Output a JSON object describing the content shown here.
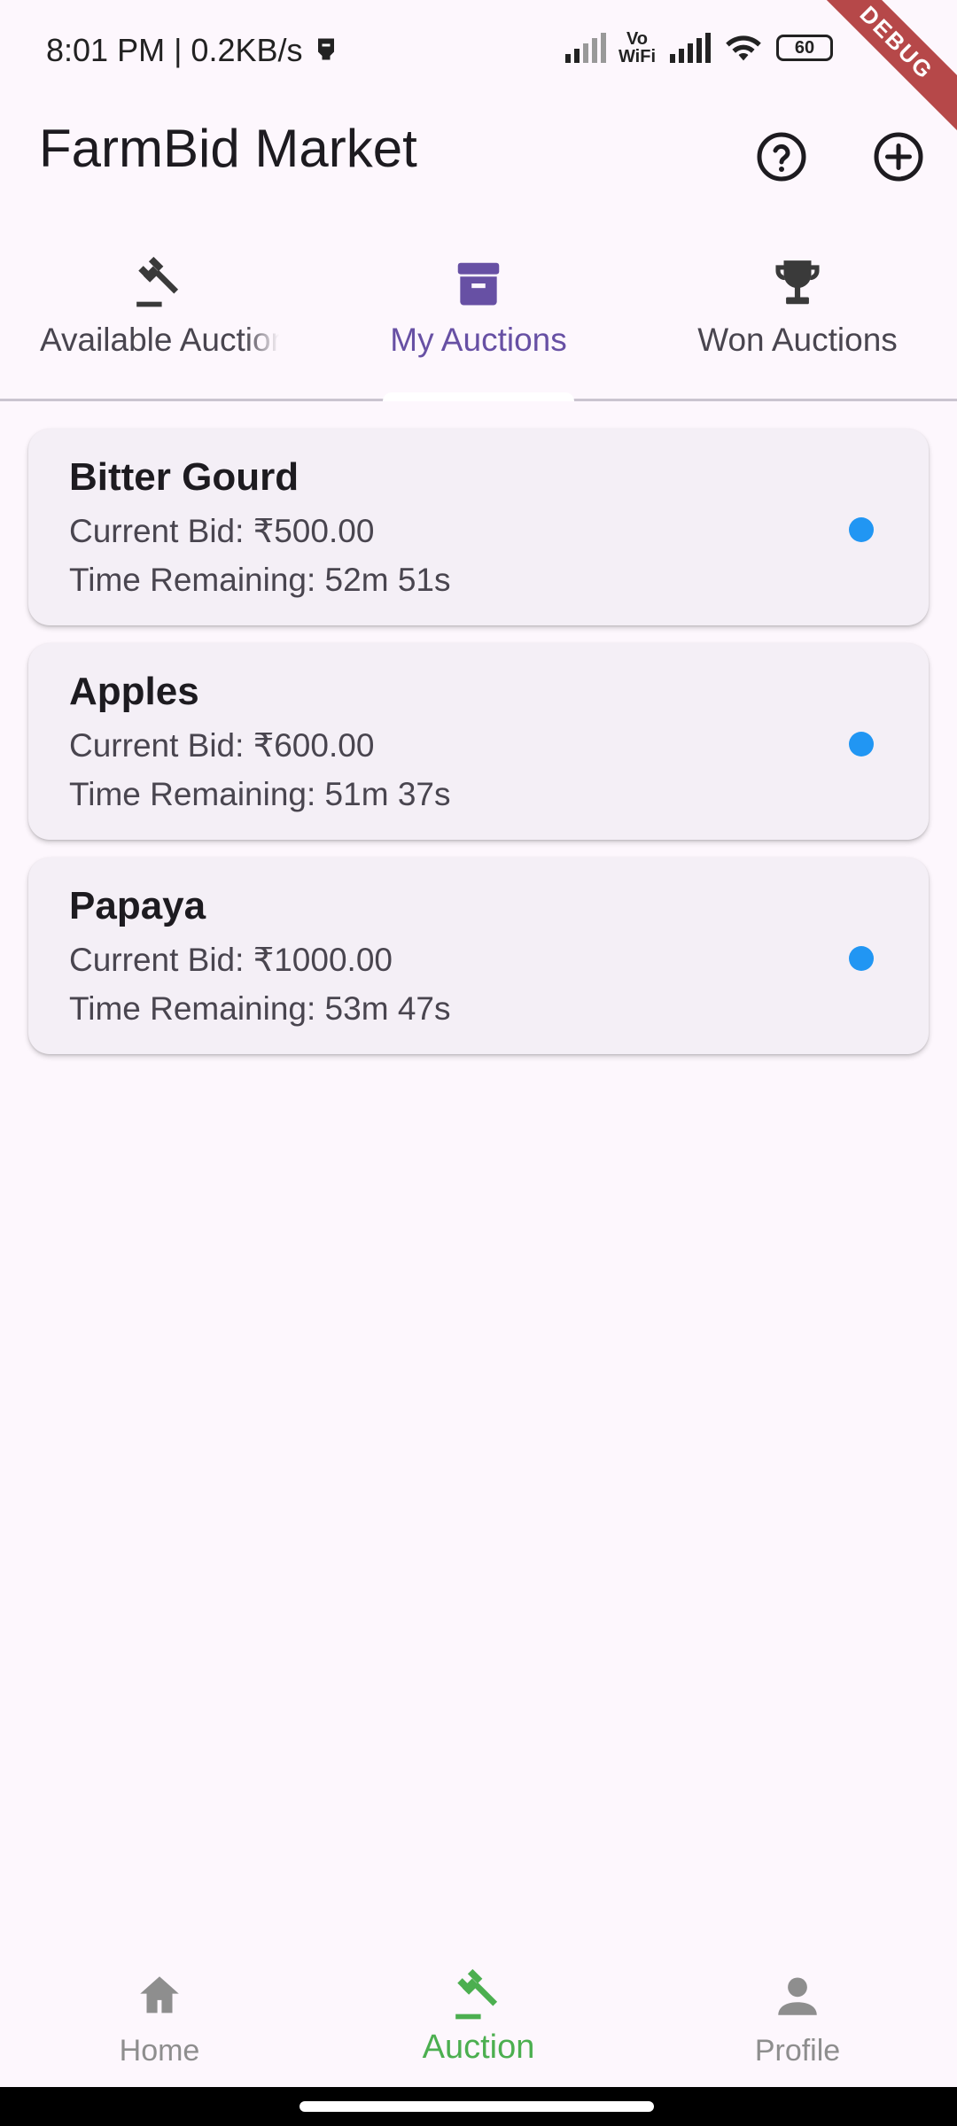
{
  "status_bar": {
    "time_speed": "8:01 PM | 0.2KB/s",
    "vowifi_top": "Vo",
    "vowifi_bottom": "WiFi",
    "battery": "60",
    "debug_banner": "DEBUG"
  },
  "app_bar": {
    "title": "FarmBid Market",
    "help_icon": "help-circle-icon",
    "add_icon": "add-circle-icon"
  },
  "tabs": [
    {
      "label": "Available Auctions",
      "icon": "gavel-icon",
      "active": false
    },
    {
      "label": "My Auctions",
      "icon": "archive-box-icon",
      "active": true
    },
    {
      "label": "Won Auctions",
      "icon": "trophy-icon",
      "active": false
    }
  ],
  "auctions": [
    {
      "name": "Bitter Gourd",
      "current_bid": "Current Bid: ₹500.00",
      "time_remaining": "Time Remaining: 52m 51s"
    },
    {
      "name": "Apples",
      "current_bid": "Current Bid: ₹600.00",
      "time_remaining": "Time Remaining: 51m 37s"
    },
    {
      "name": "Papaya",
      "current_bid": "Current Bid: ₹1000.00",
      "time_remaining": "Time Remaining: 53m 47s"
    }
  ],
  "bottom_nav": [
    {
      "label": "Home",
      "icon": "home-icon",
      "active": false
    },
    {
      "label": "Auction",
      "icon": "gavel-icon",
      "active": true
    },
    {
      "label": "Profile",
      "icon": "person-icon",
      "active": false
    }
  ],
  "colors": {
    "background": "#FDF7FD",
    "primary": "#6750A4",
    "card": "#F4EFF6",
    "status_dot": "#2196F3",
    "nav_active": "#4CAF50",
    "nav_inactive": "#8E8E8E",
    "debug": "#B03A3A"
  }
}
